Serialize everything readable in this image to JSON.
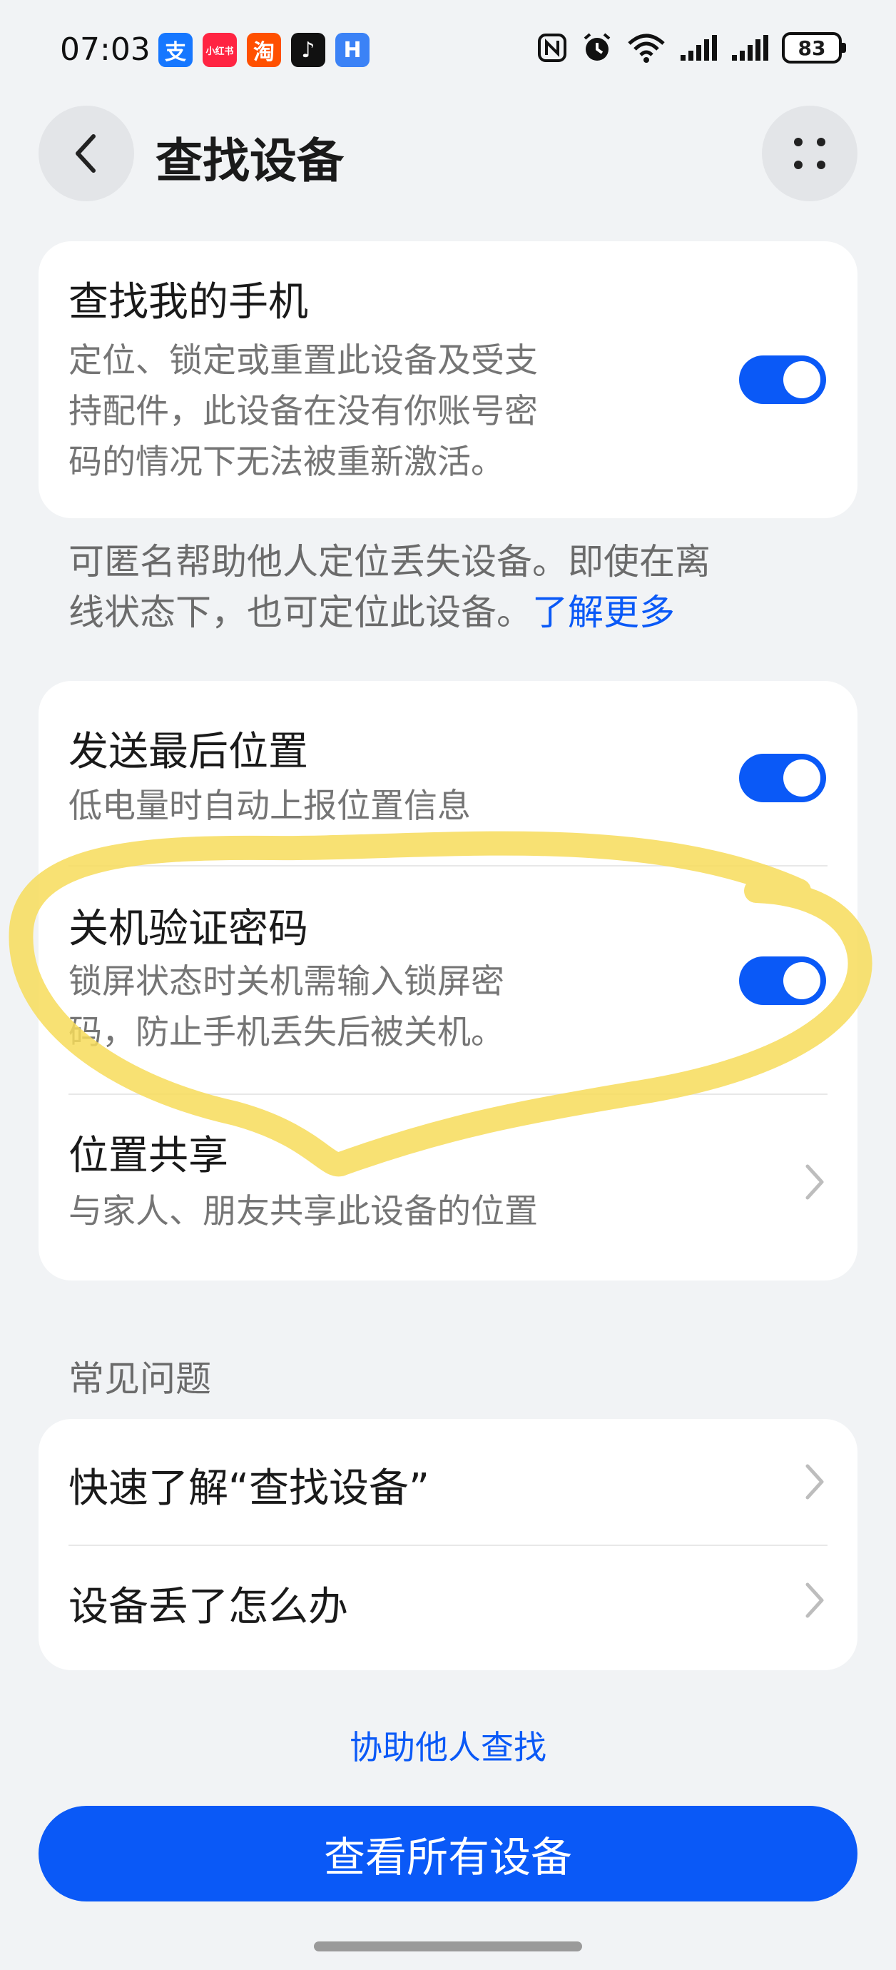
{
  "status_bar": {
    "time": "07:03",
    "apps": [
      {
        "name": "alipay-icon",
        "glyph": "支",
        "color": "#1677ff"
      },
      {
        "name": "xiaohongshu-icon",
        "glyph": "小红书",
        "color": "#ff2442"
      },
      {
        "name": "taobao-icon",
        "glyph": "淘",
        "color": "#ff5000"
      },
      {
        "name": "tiktok-icon",
        "glyph": "♪",
        "color": "#111111"
      },
      {
        "name": "app-icon",
        "glyph": "H",
        "color": "#3b82f6"
      }
    ],
    "battery": "83"
  },
  "header": {
    "title": "查找设备"
  },
  "find_my_phone": {
    "title": "查找我的手机",
    "desc_lines": [
      "定位、锁定或重置此设备及受支",
      "持配件，此设备在没有你账号密",
      "码的情况下无法被重新激活。"
    ],
    "enabled": true
  },
  "offline_note": {
    "line1": "可匿名帮助他人定位丢失设备。即使在离",
    "line2": "线状态下，也可定位此设备。",
    "link": "了解更多"
  },
  "settings": [
    {
      "title": "发送最后位置",
      "desc_lines": [
        "低电量时自动上报位置信息"
      ],
      "enabled": true
    },
    {
      "title": "关机验证密码",
      "desc_lines": [
        "锁屏状态时关机需输入锁屏密",
        "码，防止手机丢失后被关机。"
      ],
      "enabled": true
    },
    {
      "title": "位置共享",
      "desc_lines": [
        "与家人、朋友共享此设备的位置"
      ]
    }
  ],
  "faq": {
    "label": "常见问题",
    "items": [
      "快速了解“查找设备”",
      "设备丢了怎么办"
    ]
  },
  "assist_link": "协助他人查找",
  "primary_button": "查看所有设备",
  "accent_color": "#0a59f7",
  "highlight_color": "#f7dc5a"
}
